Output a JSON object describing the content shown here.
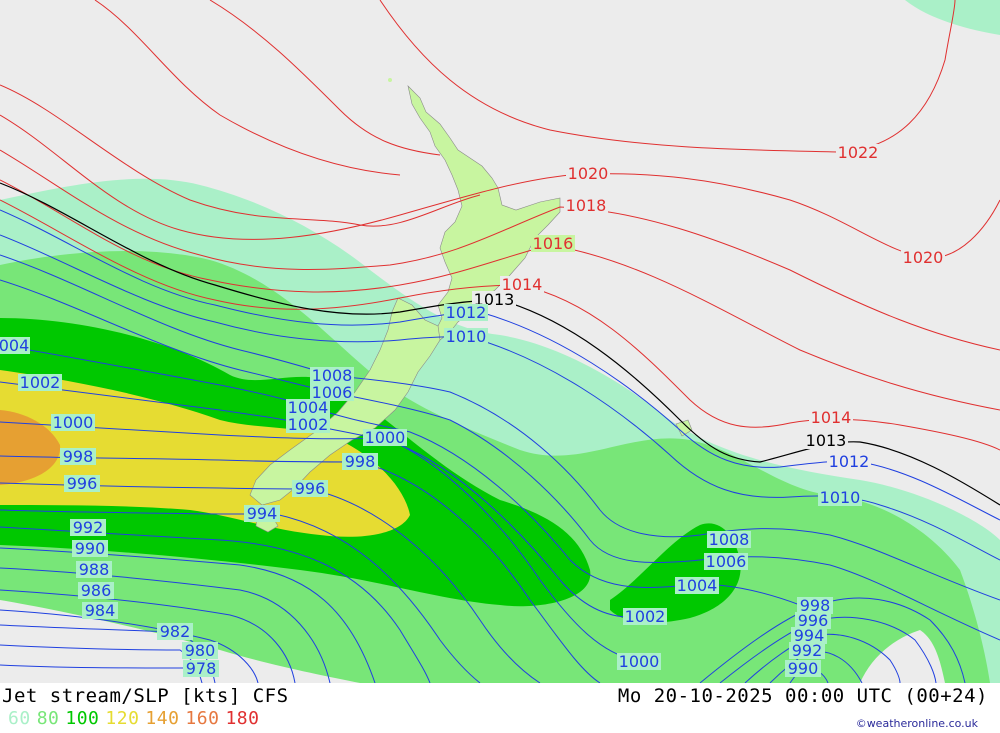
{
  "map": {
    "colors": {
      "background": "#ececec",
      "land": "#c8f5a0",
      "speed_60": "#aaf0c8",
      "speed_80": "#78e678",
      "speed_100": "#00c800",
      "speed_120": "#e6dc32",
      "speed_140": "#e6a032",
      "isobar_high": "#e03030",
      "isobar_low": "#2040e0",
      "isobar_ref": "#000000"
    },
    "isobar_labels": [
      {
        "id": "1022",
        "text": "1022",
        "cls": "high"
      },
      {
        "id": "1020a",
        "text": "1020",
        "cls": "high"
      },
      {
        "id": "1020b",
        "text": "1020",
        "cls": "high"
      },
      {
        "id": "1018",
        "text": "1018",
        "cls": "high"
      },
      {
        "id": "1016",
        "text": "1016",
        "cls": "high"
      },
      {
        "id": "1014a",
        "text": "1014",
        "cls": "high"
      },
      {
        "id": "1014b",
        "text": "1014",
        "cls": "high"
      },
      {
        "id": "1013a",
        "text": "1013",
        "cls": "ref"
      },
      {
        "id": "1013b",
        "text": "1013",
        "cls": "ref"
      },
      {
        "id": "1012a",
        "text": "1012",
        "cls": "low"
      },
      {
        "id": "1012b",
        "text": "1012",
        "cls": "low"
      },
      {
        "id": "1010a",
        "text": "1010",
        "cls": "low"
      },
      {
        "id": "1010b",
        "text": "1010",
        "cls": "low"
      },
      {
        "id": "1008a",
        "text": "1008",
        "cls": "low"
      },
      {
        "id": "1008b",
        "text": "1008",
        "cls": "low"
      },
      {
        "id": "1006a",
        "text": "1006",
        "cls": "low"
      },
      {
        "id": "1006b",
        "text": "1006",
        "cls": "low"
      },
      {
        "id": "1004a",
        "text": "004",
        "cls": "low"
      },
      {
        "id": "1004b",
        "text": "1004",
        "cls": "low"
      },
      {
        "id": "1004c",
        "text": "1004",
        "cls": "low"
      },
      {
        "id": "1002a",
        "text": "1002",
        "cls": "low"
      },
      {
        "id": "1002b",
        "text": "1002",
        "cls": "low"
      },
      {
        "id": "1002c",
        "text": "1002",
        "cls": "low"
      },
      {
        "id": "1000a",
        "text": "1000",
        "cls": "low"
      },
      {
        "id": "1000b",
        "text": "1000",
        "cls": "low"
      },
      {
        "id": "1000c",
        "text": "1000",
        "cls": "low"
      },
      {
        "id": "998a",
        "text": "998",
        "cls": "low"
      },
      {
        "id": "998b",
        "text": "998",
        "cls": "low"
      },
      {
        "id": "998c",
        "text": "998",
        "cls": "low"
      },
      {
        "id": "996a",
        "text": "996",
        "cls": "low"
      },
      {
        "id": "996b",
        "text": "996",
        "cls": "low"
      },
      {
        "id": "996c",
        "text": "996",
        "cls": "low"
      },
      {
        "id": "994a",
        "text": "994",
        "cls": "low"
      },
      {
        "id": "994b",
        "text": "994",
        "cls": "low"
      },
      {
        "id": "992a",
        "text": "992",
        "cls": "low"
      },
      {
        "id": "992b",
        "text": "992",
        "cls": "low"
      },
      {
        "id": "990a",
        "text": "990",
        "cls": "low"
      },
      {
        "id": "990b",
        "text": "990",
        "cls": "low"
      },
      {
        "id": "988",
        "text": "988",
        "cls": "low"
      },
      {
        "id": "986",
        "text": "986",
        "cls": "low"
      },
      {
        "id": "984",
        "text": "984",
        "cls": "low"
      },
      {
        "id": "982",
        "text": "982",
        "cls": "low"
      },
      {
        "id": "980",
        "text": "980",
        "cls": "low"
      },
      {
        "id": "978",
        "text": "978",
        "cls": "low"
      }
    ]
  },
  "footer": {
    "title": "Jet stream/SLP [kts] CFS",
    "datetime": "Mo 20-10-2025 00:00 UTC (00+24)",
    "credit": "©weatheronline.co.uk",
    "scale": [
      {
        "label": "60",
        "color": "#aaf0c8"
      },
      {
        "label": "80",
        "color": "#78e678"
      },
      {
        "label": "100",
        "color": "#00c800"
      },
      {
        "label": "120",
        "color": "#e6dc32"
      },
      {
        "label": "140",
        "color": "#e6a032"
      },
      {
        "label": "160",
        "color": "#e67840"
      },
      {
        "label": "180",
        "color": "#e03030"
      }
    ]
  }
}
